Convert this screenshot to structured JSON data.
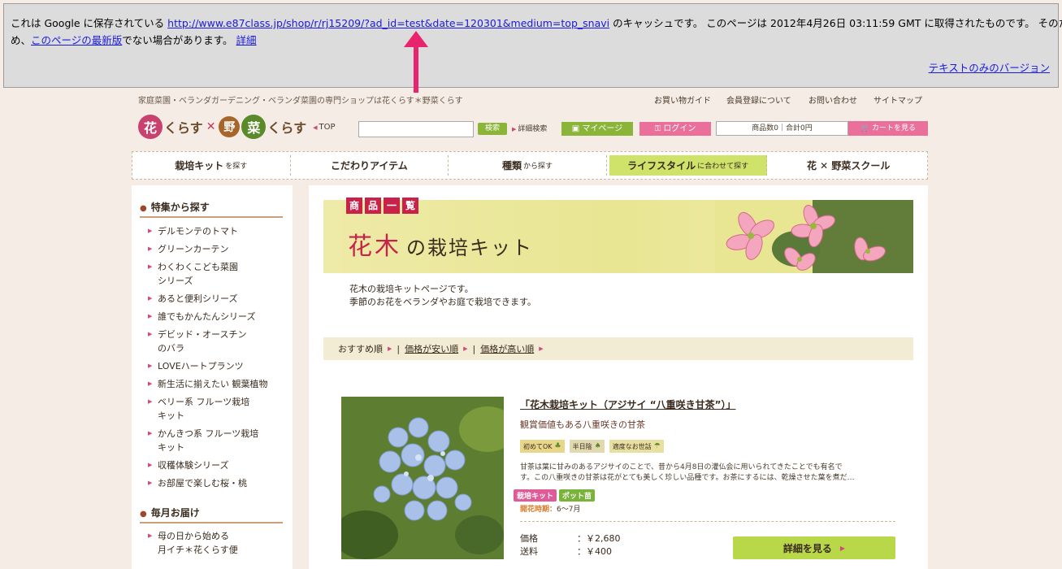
{
  "cache_banner": {
    "line1_prefix": "これは Google に保存されている ",
    "cached_url": "http://www.e87class.jp/shop/r/rj15209/?ad_id=test&date=120301&medium=top_snavi",
    "line1_suffix": " のキャッシュです。 このページは 2012年4月26日 03:11:59 GMT に取得されたものです。 そのた",
    "line2_prefix": "め、",
    "latest_link": "このページの最新版",
    "line2_suffix": "でない場合があります。 ",
    "details_link": "詳細",
    "text_only_link": "テキストのみのバージョン"
  },
  "header": {
    "tagline": "家庭菜園・ベランダガーデニング・ベランダ菜園の専門ショップは花くらす＊野菜くらす",
    "top_links": [
      "お買い物ガイド",
      "会員登録について",
      "お問い合わせ",
      "サイトマップ"
    ],
    "logo": {
      "hana": "花",
      "kurasu1": "くらす",
      "cross": "✕",
      "ya": "野",
      "sai": "菜",
      "kurasu2": "くらす",
      "top": "TOP"
    },
    "search_button": "検索",
    "advanced_search": "詳細検索",
    "mypage": "マイページ",
    "login": "ログイン",
    "cart_summary": "商品数0｜合計0円",
    "cart_button": "カートを見る"
  },
  "mainnav": [
    {
      "label": "栽培キット",
      "small": "を探す"
    },
    {
      "label": "こだわりアイテム",
      "small": ""
    },
    {
      "label": "種類",
      "small": "から探す"
    },
    {
      "label": "ライフスタイル",
      "small": "に合わせて探す"
    },
    {
      "label": "花 ✕ 野菜スクール",
      "small": ""
    }
  ],
  "sidebar": {
    "section1_title": "特集から探す",
    "section1_items": [
      "デルモンテのトマト",
      "グリーンカーテン",
      "わくわくこども菜園\nシリーズ",
      "あると便利シリーズ",
      "誰でもかんたんシリーズ",
      "デビッド・オースチン\nのバラ",
      "LOVEハートプランツ",
      "新生活に揃えたい 観葉植物",
      "ベリー系 フルーツ栽培\nキット",
      "かんきつ系 フルーツ栽培\nキット",
      "収穫体験シリーズ",
      "お部屋で楽しむ桜・桃"
    ],
    "section2_title": "毎月お届け",
    "section2_items": [
      "母の日から始める\n月イチ＊花くらす便"
    ]
  },
  "banner": {
    "tag_chars": [
      "商",
      "品",
      "一",
      "覧"
    ],
    "title_main": "花木",
    "title_rest": "の栽培キット"
  },
  "intro": {
    "line1": "花木の栽培キットページです。",
    "line2": "季節のお花をベランダやお庭で栽培できます。"
  },
  "sort": {
    "recommended": "おすすめ順",
    "price_low": "価格が安い順",
    "price_high": "価格が高い順"
  },
  "product": {
    "title": "「花木栽培キット（アジサイ “八重咲き甘茶”）」",
    "subtitle": "観賞価値もある八重咲きの甘茶",
    "badges": [
      "初めてOK",
      "半日陰",
      "適度なお世話"
    ],
    "description": "甘茶は葉に甘みのあるアジサイのことで、昔から4月8日の灌仏会に用いられてきたことでも有名で",
    "description2": "す。この八重咲きの甘茶は花がとても美しく珍しい品種です。お茶にするには、乾燥させた葉を煮だ…",
    "tags": [
      "栽培キット",
      "ポット苗"
    ],
    "bloom_label": "開花時期：",
    "bloom_value": "6〜7月",
    "price_label": "価格",
    "price_value": "：￥2,680",
    "shipping_label": "送料",
    "shipping_value": "：￥400",
    "detail_button": "詳細を見る"
  },
  "colors": {
    "accent_pink": "#d24a7a",
    "accent_green": "#8ab538",
    "brand_red": "#c8224a"
  }
}
